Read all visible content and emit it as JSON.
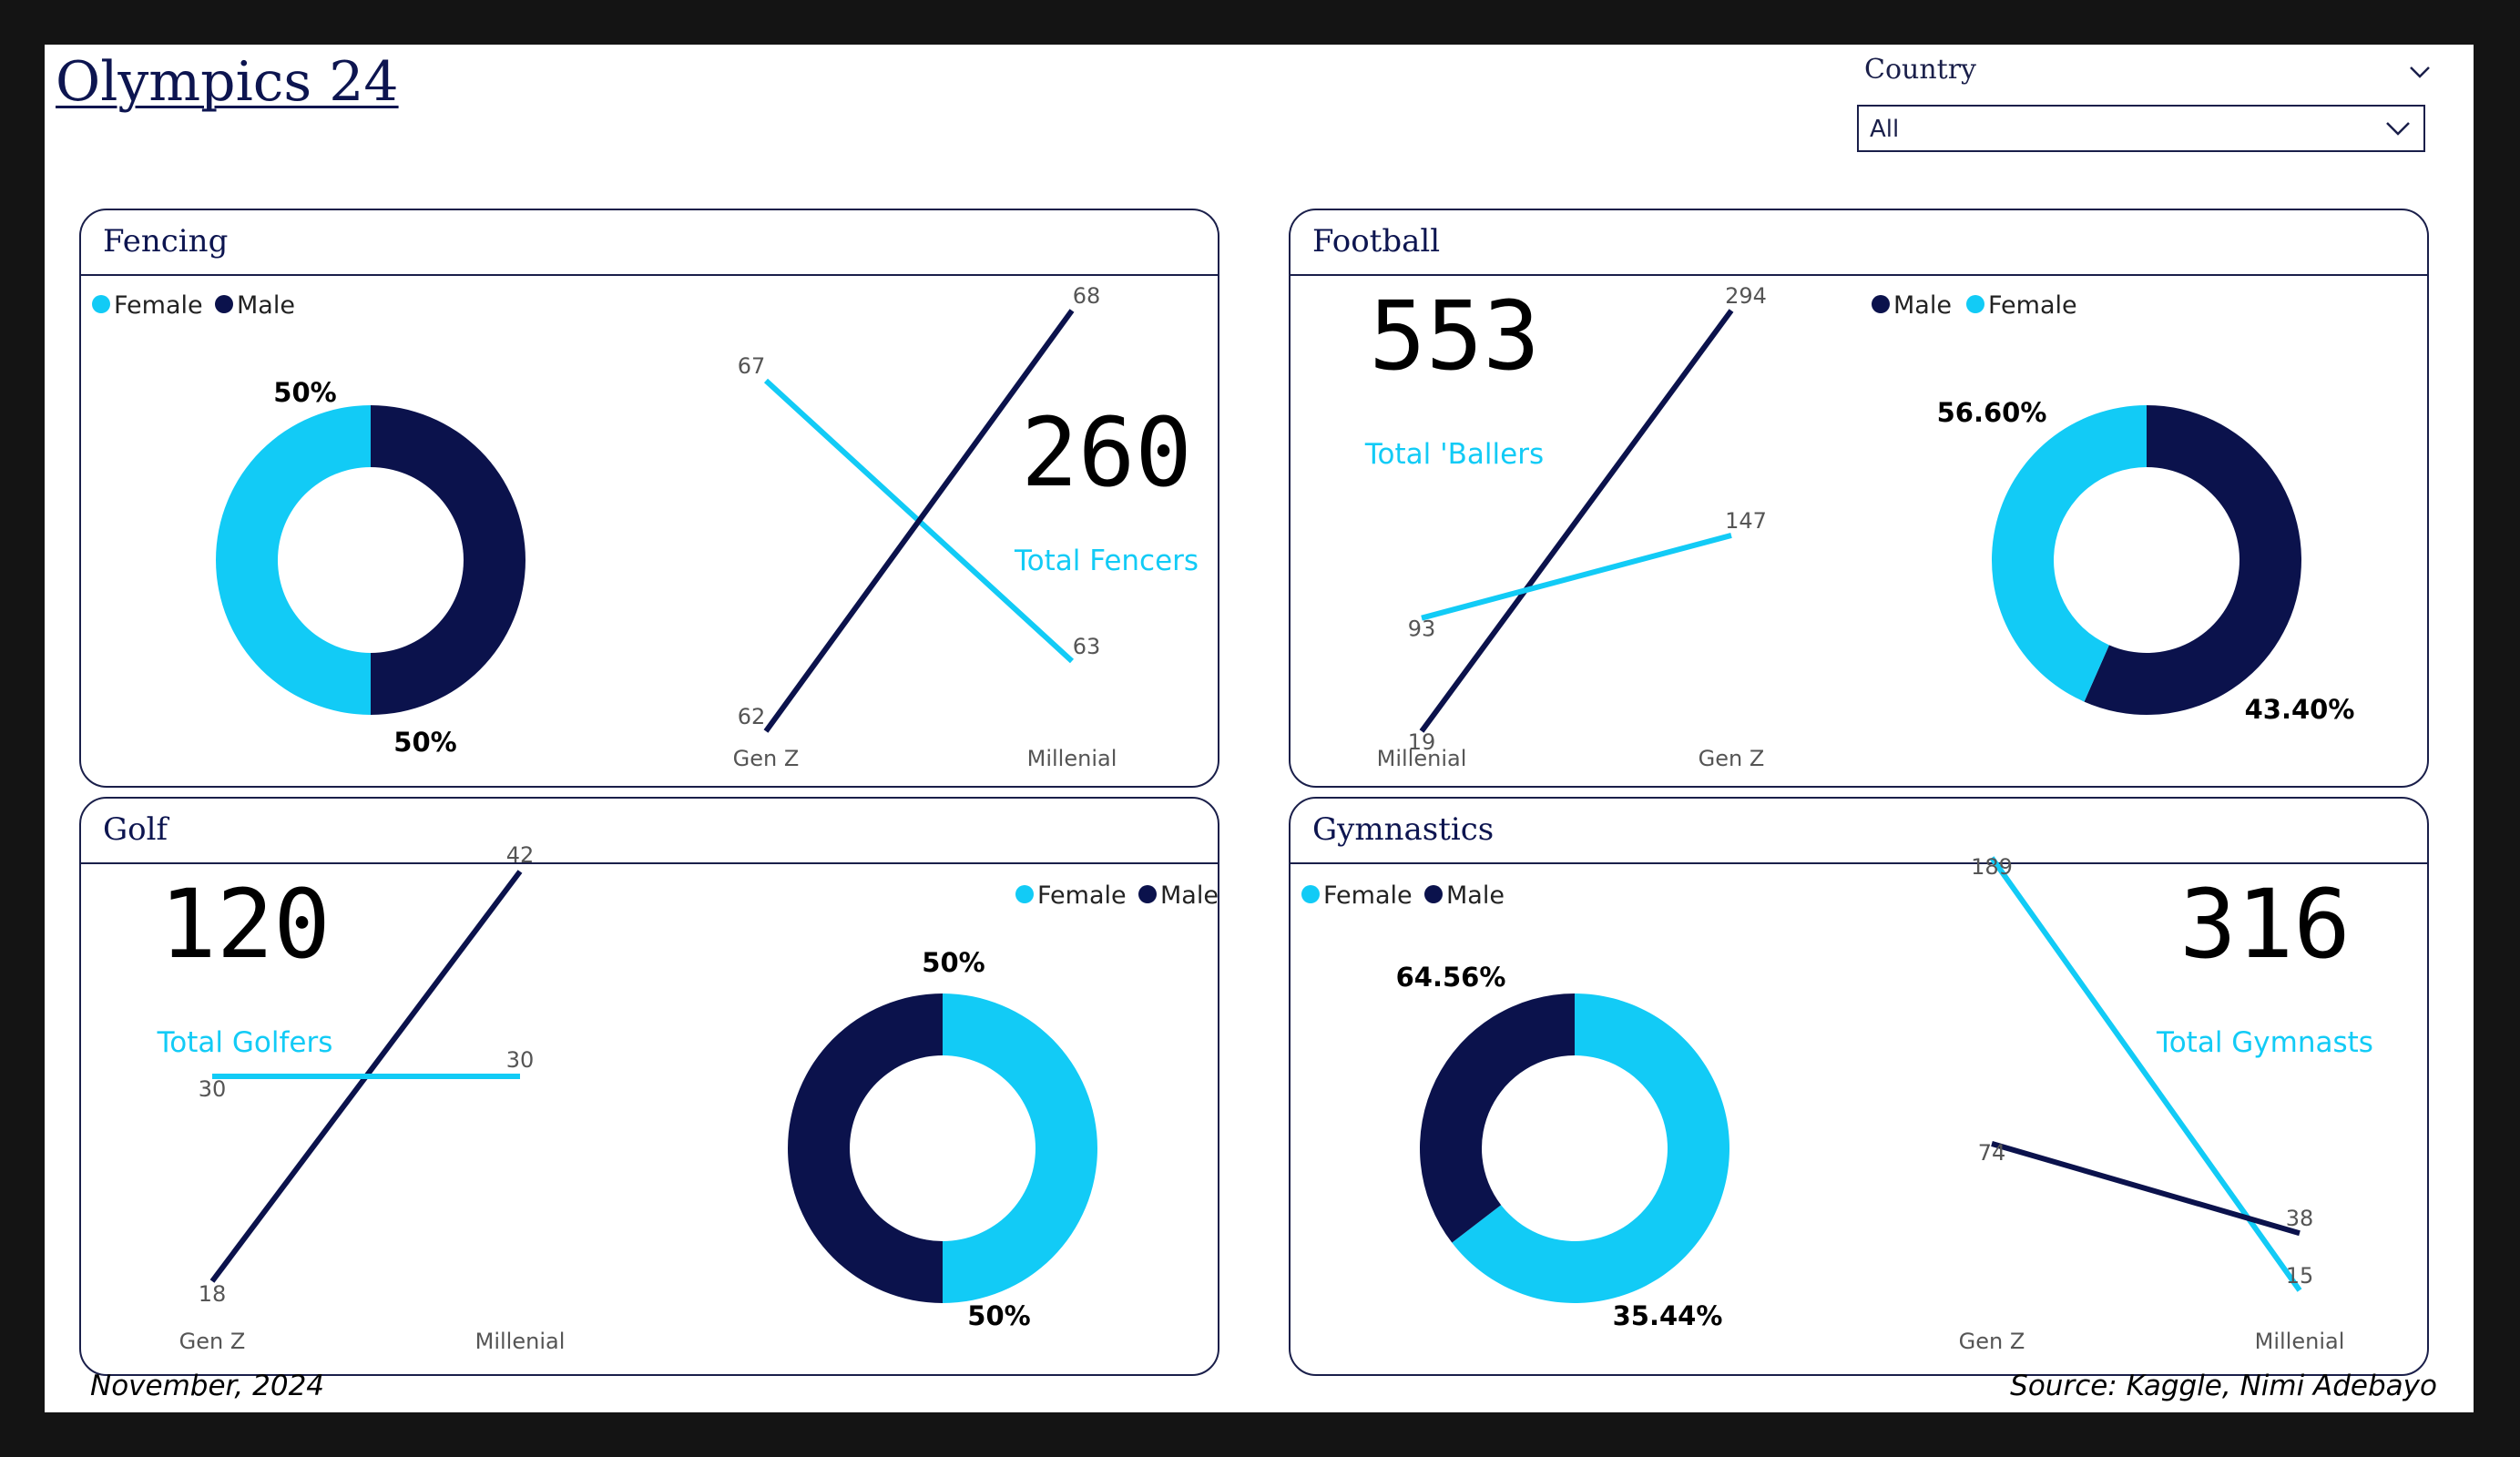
{
  "title": "Olympics 24",
  "slicer": {
    "label": "Country",
    "value": "All"
  },
  "colors": {
    "female": "#12cbf6",
    "male": "#0b124c",
    "border": "#1a1f4a"
  },
  "footer": {
    "left": "November, 2024",
    "right": "Source: Kaggle, Nimi Adebayo"
  },
  "cards": [
    {
      "key": "fencing",
      "title": "Fencing"
    },
    {
      "key": "football",
      "title": "Football"
    },
    {
      "key": "golf",
      "title": "Golf"
    },
    {
      "key": "gymnastics",
      "title": "Gymnastics"
    }
  ],
  "chart_data": [
    {
      "type": "pie",
      "panel": "Fencing",
      "legend": [
        "Female",
        "Male"
      ],
      "slices": [
        {
          "label": "Male",
          "value": 50,
          "text": "50%"
        },
        {
          "label": "Female",
          "value": 50,
          "text": "50%"
        }
      ]
    },
    {
      "type": "line",
      "panel": "Fencing",
      "categories": [
        "Gen Z",
        "Millenial"
      ],
      "series": [
        {
          "name": "Female",
          "values": [
            67,
            63
          ]
        },
        {
          "name": "Male",
          "values": [
            62,
            68
          ]
        }
      ],
      "card_value": "260",
      "card_label": "Total Fencers"
    },
    {
      "type": "line",
      "panel": "Football",
      "categories": [
        "Millenial",
        "Gen Z"
      ],
      "series": [
        {
          "name": "Male",
          "values": [
            19,
            294
          ]
        },
        {
          "name": "Female",
          "values": [
            93,
            147
          ]
        }
      ],
      "card_value": "553",
      "card_label": "Total 'Ballers"
    },
    {
      "type": "pie",
      "panel": "Football",
      "legend": [
        "Male",
        "Female"
      ],
      "slices": [
        {
          "label": "Male",
          "value": 56.6,
          "text": "56.60%"
        },
        {
          "label": "Female",
          "value": 43.4,
          "text": "43.40%"
        }
      ]
    },
    {
      "type": "line",
      "panel": "Golf",
      "categories": [
        "Gen Z",
        "Millenial"
      ],
      "series": [
        {
          "name": "Male",
          "values": [
            18,
            42
          ]
        },
        {
          "name": "Female",
          "values": [
            30,
            30
          ]
        }
      ],
      "card_value": "120",
      "card_label": "Total Golfers"
    },
    {
      "type": "pie",
      "panel": "Golf",
      "legend": [
        "Female",
        "Male"
      ],
      "slices": [
        {
          "label": "Female",
          "value": 50,
          "text": "50%"
        },
        {
          "label": "Male",
          "value": 50,
          "text": "50%"
        }
      ]
    },
    {
      "type": "pie",
      "panel": "Gymnastics",
      "legend": [
        "Female",
        "Male"
      ],
      "slices": [
        {
          "label": "Female",
          "value": 64.56,
          "text": "64.56%"
        },
        {
          "label": "Male",
          "value": 35.44,
          "text": "35.44%"
        }
      ]
    },
    {
      "type": "line",
      "panel": "Gymnastics",
      "categories": [
        "Gen Z",
        "Millenial"
      ],
      "series": [
        {
          "name": "Female",
          "values": [
            189,
            15
          ]
        },
        {
          "name": "Male",
          "values": [
            74,
            38
          ]
        }
      ],
      "card_value": "316",
      "card_label": "Total Gymnasts"
    }
  ]
}
